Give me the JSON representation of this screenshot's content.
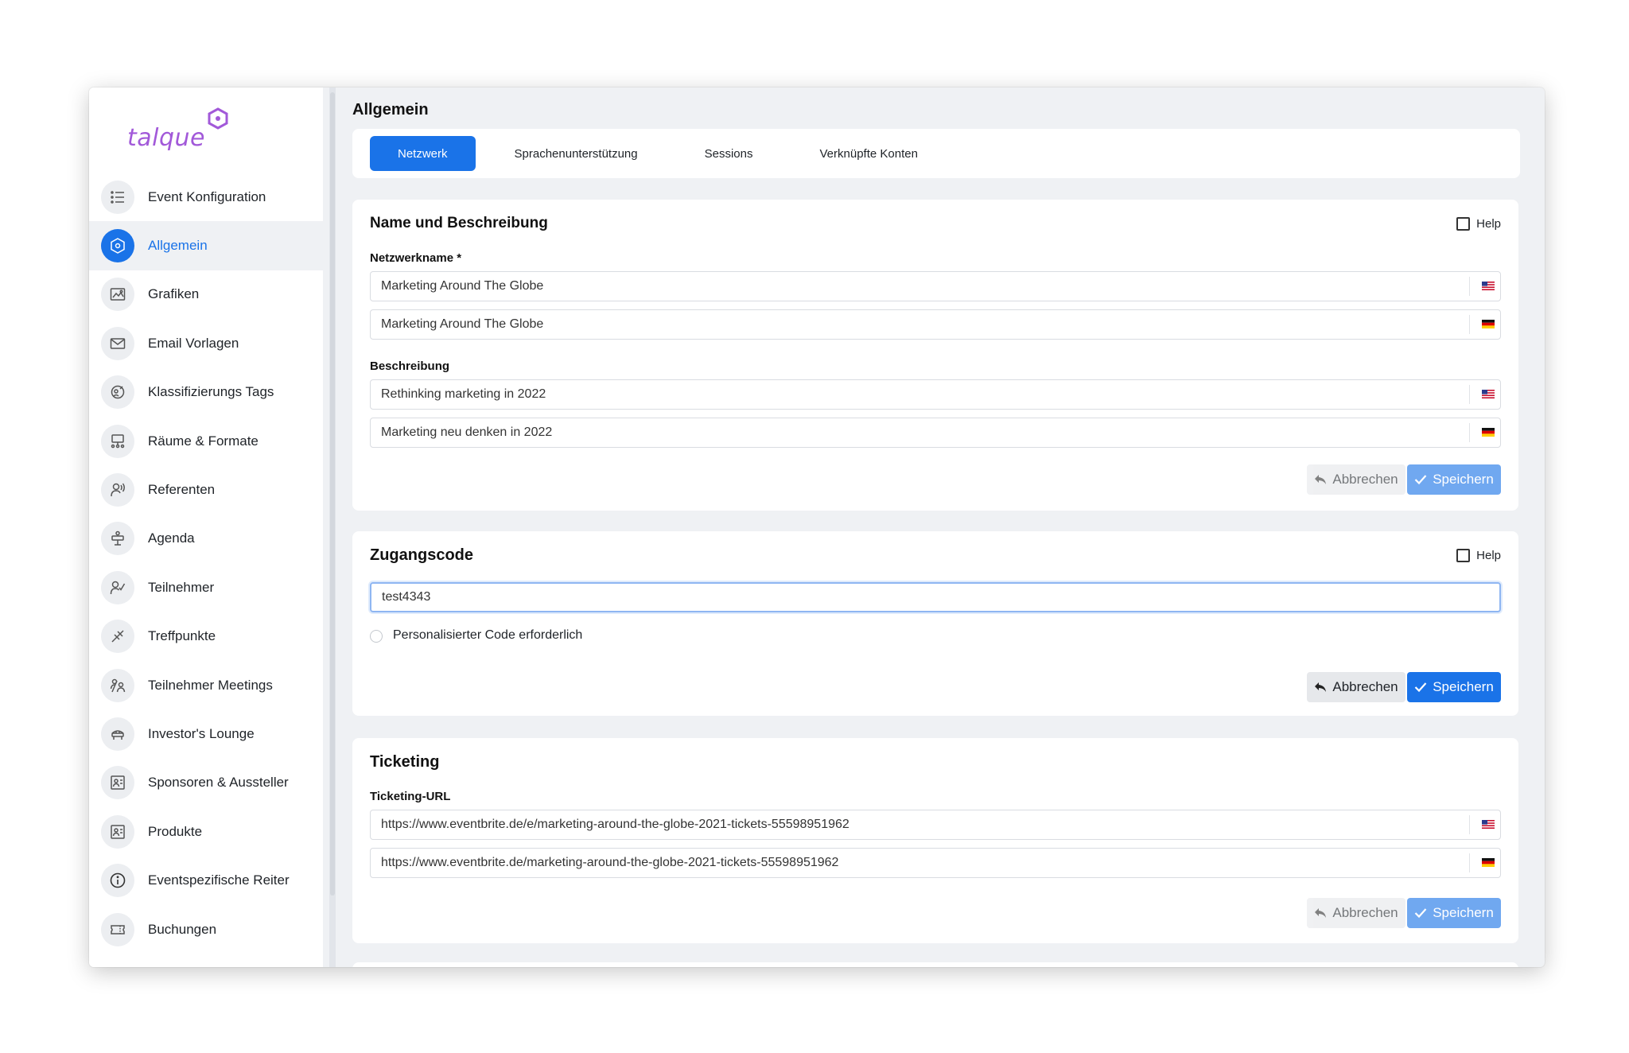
{
  "app": {
    "logo_text": "talque",
    "brand_color": "#a259d9",
    "accent_color": "#1a73e8"
  },
  "sidebar": {
    "items": [
      {
        "label": "Event Konfiguration",
        "icon": "list-icon"
      },
      {
        "label": "Allgemein",
        "icon": "settings-hex-icon",
        "active": true
      },
      {
        "label": "Grafiken",
        "icon": "image-icon"
      },
      {
        "label": "Email Vorlagen",
        "icon": "mail-icon"
      },
      {
        "label": "Klassifizierungs Tags",
        "icon": "tags-icon"
      },
      {
        "label": "Räume & Formate",
        "icon": "rooms-icon"
      },
      {
        "label": "Referenten",
        "icon": "speaker-icon"
      },
      {
        "label": "Agenda",
        "icon": "agenda-icon"
      },
      {
        "label": "Teilnehmer",
        "icon": "participant-icon"
      },
      {
        "label": "Treffpunkte",
        "icon": "meeting-point-icon"
      },
      {
        "label": "Teilnehmer Meetings",
        "icon": "meetings-icon"
      },
      {
        "label": "Investor's Lounge",
        "icon": "lounge-icon"
      },
      {
        "label": "Sponsoren & Aussteller",
        "icon": "sponsor-icon"
      },
      {
        "label": "Produkte",
        "icon": "product-icon"
      },
      {
        "label": "Eventspezifische Reiter",
        "icon": "info-icon"
      },
      {
        "label": "Buchungen",
        "icon": "ticket-icon"
      }
    ]
  },
  "main": {
    "title": "Allgemein",
    "tabs": [
      {
        "label": "Netzwerk",
        "active": true
      },
      {
        "label": "Sprachenunterstützung"
      },
      {
        "label": "Sessions"
      },
      {
        "label": "Verknüpfte Konten"
      }
    ]
  },
  "name_card": {
    "title": "Name und Beschreibung",
    "help_label": "Help",
    "name_label": "Netzwerkname *",
    "name_en": "Marketing Around The Globe",
    "name_de": "Marketing Around The Globe",
    "desc_label": "Beschreibung",
    "desc_en": "Rethinking marketing in 2022",
    "desc_de": "Marketing neu denken in 2022",
    "cancel_label": "Abbrechen",
    "save_label": "Speichern"
  },
  "access_card": {
    "title": "Zugangscode",
    "help_label": "Help",
    "code_value": "test4343",
    "personalized_label": "Personalisierter Code erforderlich",
    "cancel_label": "Abbrechen",
    "save_label": "Speichern"
  },
  "ticketing_card": {
    "title": "Ticketing",
    "url_label": "Ticketing-URL",
    "url_en": "https://www.eventbrite.de/e/marketing-around-the-globe-2021-tickets-55598951962",
    "url_de": "https://www.eventbrite.de/marketing-around-the-globe-2021-tickets-55598951962",
    "cancel_label": "Abbrechen",
    "save_label": "Speichern"
  }
}
